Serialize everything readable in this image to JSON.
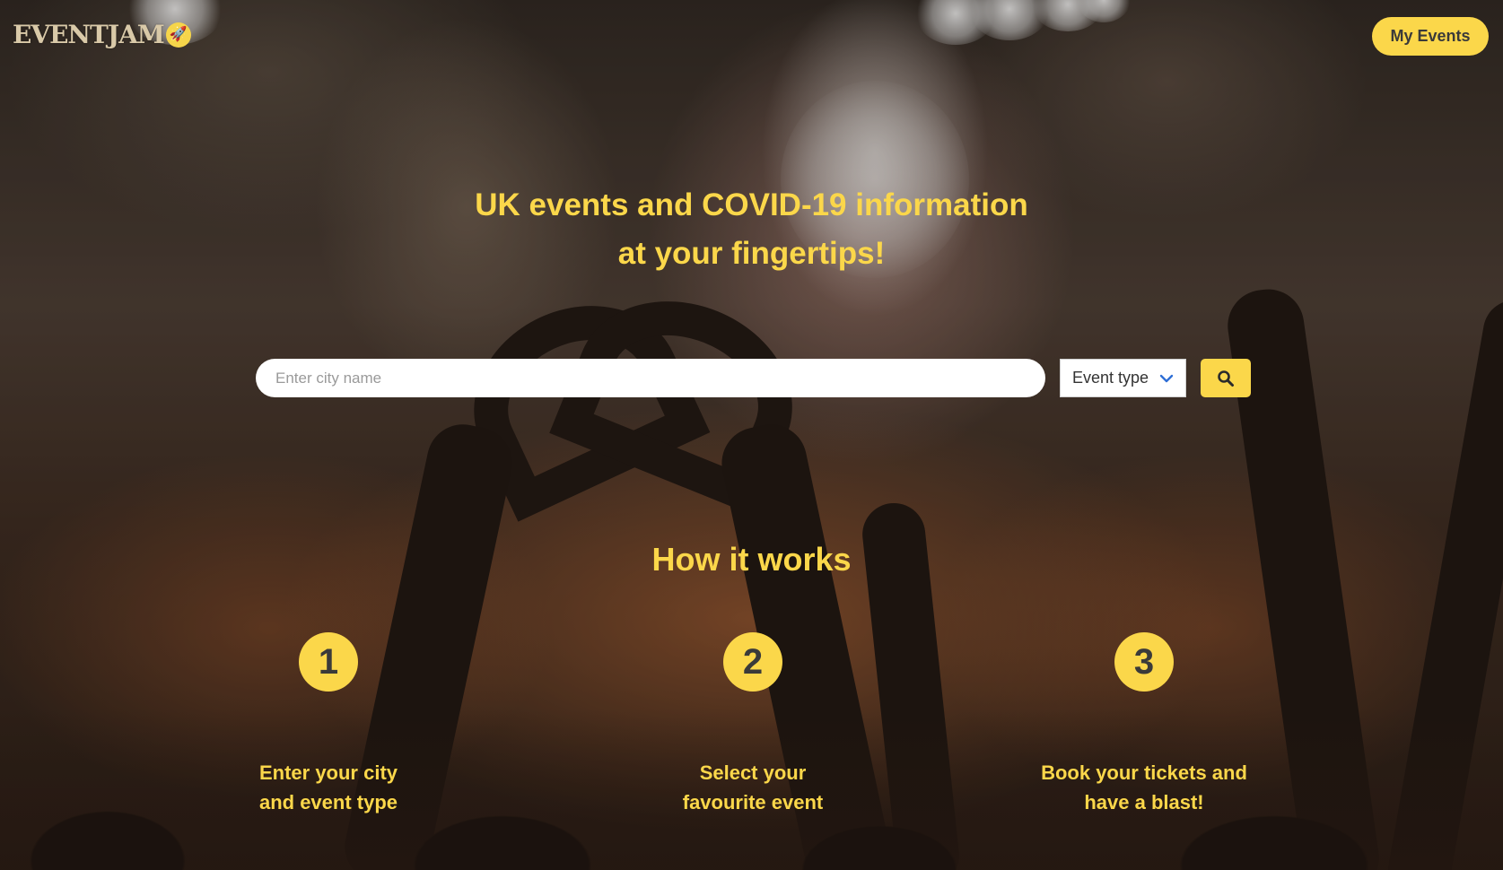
{
  "header": {
    "logo_text": "EVENTJAM",
    "my_events_label": "My Events"
  },
  "hero": {
    "title_line1": "UK events and COVID-19 information",
    "title_line2": "at your fingertips!"
  },
  "search": {
    "city_placeholder": "Enter city name",
    "event_type_label": "Event type"
  },
  "how_it_works": {
    "title": "How it works",
    "steps": [
      {
        "number": "1",
        "text": "Enter your city and event type"
      },
      {
        "number": "2",
        "text": "Select your favourite event"
      },
      {
        "number": "3",
        "text": "Book your tickets and have a blast!"
      }
    ]
  },
  "colors": {
    "accent": "#fbd74a",
    "button_text": "#3a3a3a"
  }
}
